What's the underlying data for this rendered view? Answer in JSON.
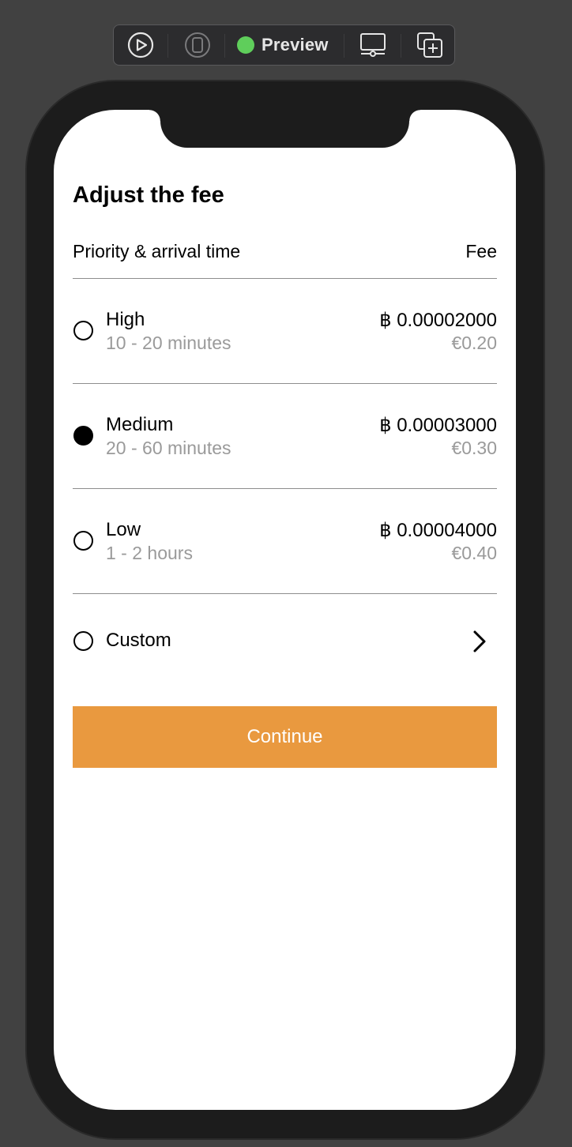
{
  "toolbar": {
    "live_icon": "play-circle-icon",
    "device_icon": "device-selector-icon",
    "preview_label": "Preview",
    "preview_status_color": "#5fce5b",
    "display_icon": "display-settings-icon",
    "duplicate_icon": "duplicate-preview-icon"
  },
  "screen": {
    "title": "Adjust the fee",
    "header": {
      "left": "Priority & arrival time",
      "right": "Fee"
    },
    "options": [
      {
        "label": "High",
        "sub": "10 - 20 minutes",
        "btc": "฿ 0.00002000",
        "fiat": "€0.20",
        "selected": false
      },
      {
        "label": "Medium",
        "sub": "20 - 60 minutes",
        "btc": "฿ 0.00003000",
        "fiat": "€0.30",
        "selected": true
      },
      {
        "label": "Low",
        "sub": "1 - 2 hours",
        "btc": "฿ 0.00004000",
        "fiat": "€0.40",
        "selected": false
      }
    ],
    "custom": {
      "label": "Custom",
      "icon": "chevron-right-icon",
      "selected": false
    },
    "continue_label": "Continue",
    "accent_color": "#e9993f"
  }
}
